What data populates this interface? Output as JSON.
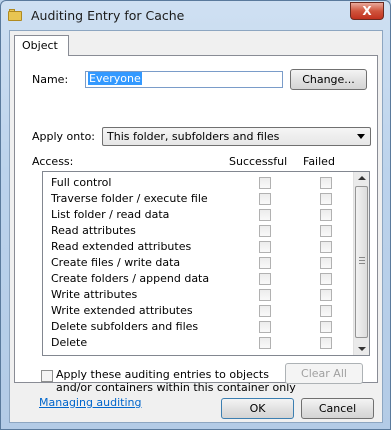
{
  "window": {
    "title": "Auditing Entry for Cache",
    "close_label": "X"
  },
  "tabs": [
    "Object"
  ],
  "name": {
    "label": "Name:",
    "value": "Everyone",
    "change_button": "Change..."
  },
  "apply_onto": {
    "label": "Apply onto:",
    "value": "This folder, subfolders and files"
  },
  "access": {
    "label": "Access:",
    "col_successful": "Successful",
    "col_failed": "Failed",
    "permissions": [
      {
        "label": "Full control",
        "successful": false,
        "failed": false
      },
      {
        "label": "Traverse folder / execute file",
        "successful": false,
        "failed": false
      },
      {
        "label": "List folder / read data",
        "successful": false,
        "failed": false
      },
      {
        "label": "Read attributes",
        "successful": false,
        "failed": false
      },
      {
        "label": "Read extended attributes",
        "successful": false,
        "failed": false
      },
      {
        "label": "Create files / write data",
        "successful": false,
        "failed": false
      },
      {
        "label": "Create folders / append data",
        "successful": false,
        "failed": false
      },
      {
        "label": "Write attributes",
        "successful": false,
        "failed": false
      },
      {
        "label": "Write extended attributes",
        "successful": false,
        "failed": false
      },
      {
        "label": "Delete subfolders and files",
        "successful": false,
        "failed": false
      },
      {
        "label": "Delete",
        "successful": false,
        "failed": false
      }
    ]
  },
  "apply_checkbox": {
    "line1": "Apply these auditing entries to objects",
    "line2": "and/or containers within this container only",
    "checked": false
  },
  "clear_all_button": "Clear All",
  "managing_link": "Managing auditing",
  "ok_button": "OK",
  "cancel_button": "Cancel"
}
